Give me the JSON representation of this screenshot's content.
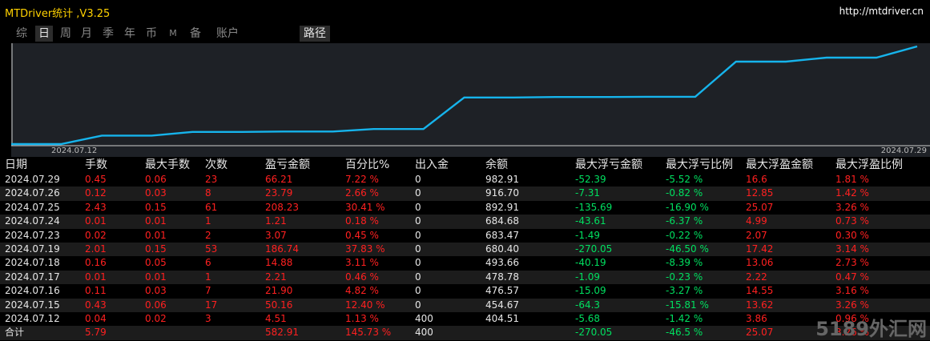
{
  "app": {
    "title": "MTDriver统计 ,V3.25",
    "site": "http://mtdriver.cn"
  },
  "tabs": [
    {
      "label": "综",
      "active": false
    },
    {
      "label": "日",
      "active": true
    },
    {
      "label": "周",
      "active": false
    },
    {
      "label": "月",
      "active": false
    },
    {
      "label": "季",
      "active": false
    },
    {
      "label": "年",
      "active": false
    },
    {
      "label": "币",
      "active": false
    },
    {
      "label": "M",
      "active": false
    },
    {
      "label": "备",
      "active": false
    },
    {
      "label": "账户",
      "active": false
    },
    {
      "label": "路径",
      "active": true
    }
  ],
  "chart_data": {
    "type": "line",
    "x_start_label": "2024.07.12",
    "x_end_label": "2024.07.29",
    "line_color": "#16b4ec",
    "x": [
      "2024.07.12",
      "2024.07.15",
      "2024.07.16",
      "2024.07.17",
      "2024.07.18",
      "2024.07.19",
      "2024.07.23",
      "2024.07.24",
      "2024.07.25",
      "2024.07.26",
      "2024.07.29"
    ],
    "values": [
      404.51,
      454.67,
      476.57,
      478.78,
      493.66,
      680.4,
      683.47,
      684.68,
      892.91,
      916.7,
      982.91
    ]
  },
  "table": {
    "headers": [
      "日期",
      "手数",
      "最大手数",
      "次数",
      "盈亏金额",
      "百分比%",
      "出入金",
      "余额",
      "最大浮亏金额",
      "最大浮亏比例",
      "最大浮盈金额",
      "最大浮盈比例"
    ],
    "rows": [
      [
        "2024.07.29",
        "0.45",
        "0.06",
        "23",
        "66.21",
        "7.22 %",
        "0",
        "982.91",
        "-52.39",
        "-5.52 %",
        "16.6",
        "1.81 %"
      ],
      [
        "2024.07.26",
        "0.12",
        "0.03",
        "8",
        "23.79",
        "2.66 %",
        "0",
        "916.70",
        "-7.31",
        "-0.82 %",
        "12.85",
        "1.42 %"
      ],
      [
        "2024.07.25",
        "2.43",
        "0.15",
        "61",
        "208.23",
        "30.41 %",
        "0",
        "892.91",
        "-135.69",
        "-16.90 %",
        "25.07",
        "3.26 %"
      ],
      [
        "2024.07.24",
        "0.01",
        "0.01",
        "1",
        "1.21",
        "0.18 %",
        "0",
        "684.68",
        "-43.61",
        "-6.37 %",
        "4.99",
        "0.73 %"
      ],
      [
        "2024.07.23",
        "0.02",
        "0.01",
        "2",
        "3.07",
        "0.45 %",
        "0",
        "683.47",
        "-1.49",
        "-0.22 %",
        "2.07",
        "0.30 %"
      ],
      [
        "2024.07.19",
        "2.01",
        "0.15",
        "53",
        "186.74",
        "37.83 %",
        "0",
        "680.40",
        "-270.05",
        "-46.50 %",
        "17.42",
        "3.14 %"
      ],
      [
        "2024.07.18",
        "0.16",
        "0.05",
        "6",
        "14.88",
        "3.11 %",
        "0",
        "493.66",
        "-40.19",
        "-8.39 %",
        "13.06",
        "2.73 %"
      ],
      [
        "2024.07.17",
        "0.01",
        "0.01",
        "1",
        "2.21",
        "0.46 %",
        "0",
        "478.78",
        "-1.09",
        "-0.23 %",
        "2.22",
        "0.47 %"
      ],
      [
        "2024.07.16",
        "0.11",
        "0.03",
        "7",
        "21.90",
        "4.82 %",
        "0",
        "476.57",
        "-15.09",
        "-3.27 %",
        "14.55",
        "3.16 %"
      ],
      [
        "2024.07.15",
        "0.43",
        "0.06",
        "17",
        "50.16",
        "12.40 %",
        "0",
        "454.67",
        "-64.3",
        "-15.81 %",
        "13.62",
        "3.26 %"
      ],
      [
        "2024.07.12",
        "0.04",
        "0.02",
        "3",
        "4.51",
        "1.13 %",
        "400",
        "404.51",
        "-5.68",
        "-1.42 %",
        "3.86",
        "0.96 %"
      ]
    ],
    "total": [
      "合计",
      "5.79",
      "",
      "",
      "582.91",
      "145.73 %",
      "400",
      "",
      "-270.05",
      "-46.5 %",
      "25.07",
      "3.26 %"
    ]
  },
  "watermark": "5189外汇网"
}
